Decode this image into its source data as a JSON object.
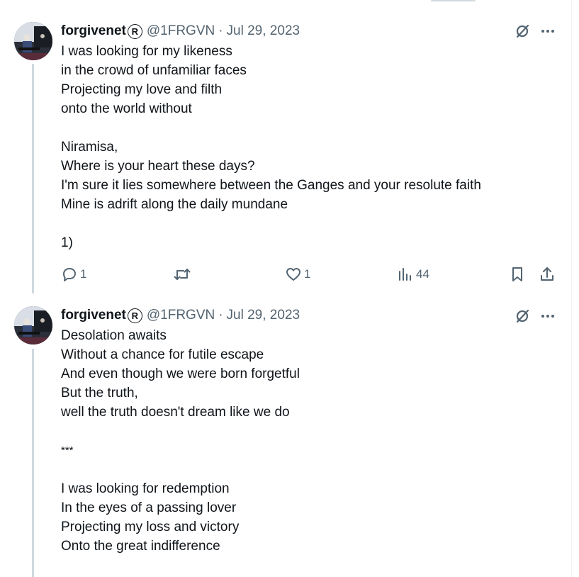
{
  "tweets": [
    {
      "author": {
        "name": "forgivenet",
        "badge": "R",
        "handle": "@1FRGVN"
      },
      "separator": "·",
      "date": "Jul 29, 2023",
      "lines": [
        "I was looking for my likeness",
        "in the crowd of unfamiliar faces",
        "Projecting my love and filth",
        "onto the world without",
        "",
        "Niramisa,",
        "Where is your heart these days?",
        "I'm sure it lies somewhere between the Ganges and your resolute faith",
        "Mine is adrift along the daily mundane",
        "",
        "1)"
      ],
      "stats": {
        "replies": "1",
        "reposts": "",
        "likes": "1",
        "views": "44"
      }
    },
    {
      "author": {
        "name": "forgivenet",
        "badge": "R",
        "handle": "@1FRGVN"
      },
      "separator": "·",
      "date": "Jul 29, 2023",
      "lines": [
        "Desolation awaits",
        "Without a chance for futile escape",
        "And even though we were born forgetful",
        "But the truth,",
        "well the truth doesn't dream like we do",
        "",
        "***",
        "",
        "I was looking for redemption",
        "In the eyes of a passing lover",
        "Projecting my loss and victory",
        "Onto the great indifference"
      ]
    }
  ],
  "icons": [
    "grok-icon",
    "more-icon",
    "reply-icon",
    "repost-icon",
    "like-icon",
    "views-icon",
    "bookmark-icon",
    "share-icon"
  ],
  "colors": {
    "text": "#0f1419",
    "secondary": "#536471",
    "thread_line": "#cfd9de"
  }
}
